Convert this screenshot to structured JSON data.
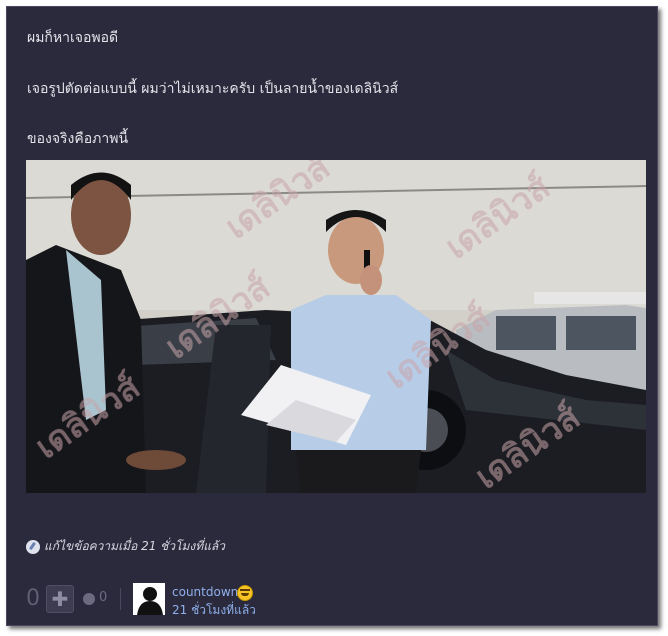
{
  "post": {
    "line1": "ผมก็หาเจอพอดี",
    "line2": "เจอรูปตัดต่อแบบนี้ ผมว่าไม่เหมาะครับ เป็นลายน้ำของเดลินิวส์",
    "line3": "ของจริงคือภาพนี้",
    "photo_watermark": "เดลินิวส์",
    "edited": "แก้ไขข้อความเมื่อ 21 ชั่วโมงที่แล้ว"
  },
  "footer": {
    "vote_count": "0",
    "plus_label": "✚",
    "emotion_count": "0",
    "username": "countdown",
    "timestamp": "21 ชั่วโมงที่แล้ว"
  },
  "icons": {
    "edit": "edit-icon",
    "plus": "plus-icon",
    "emotion": "emotion-icon",
    "smiley": "smiley-icon",
    "avatar": "avatar-silhouette"
  }
}
